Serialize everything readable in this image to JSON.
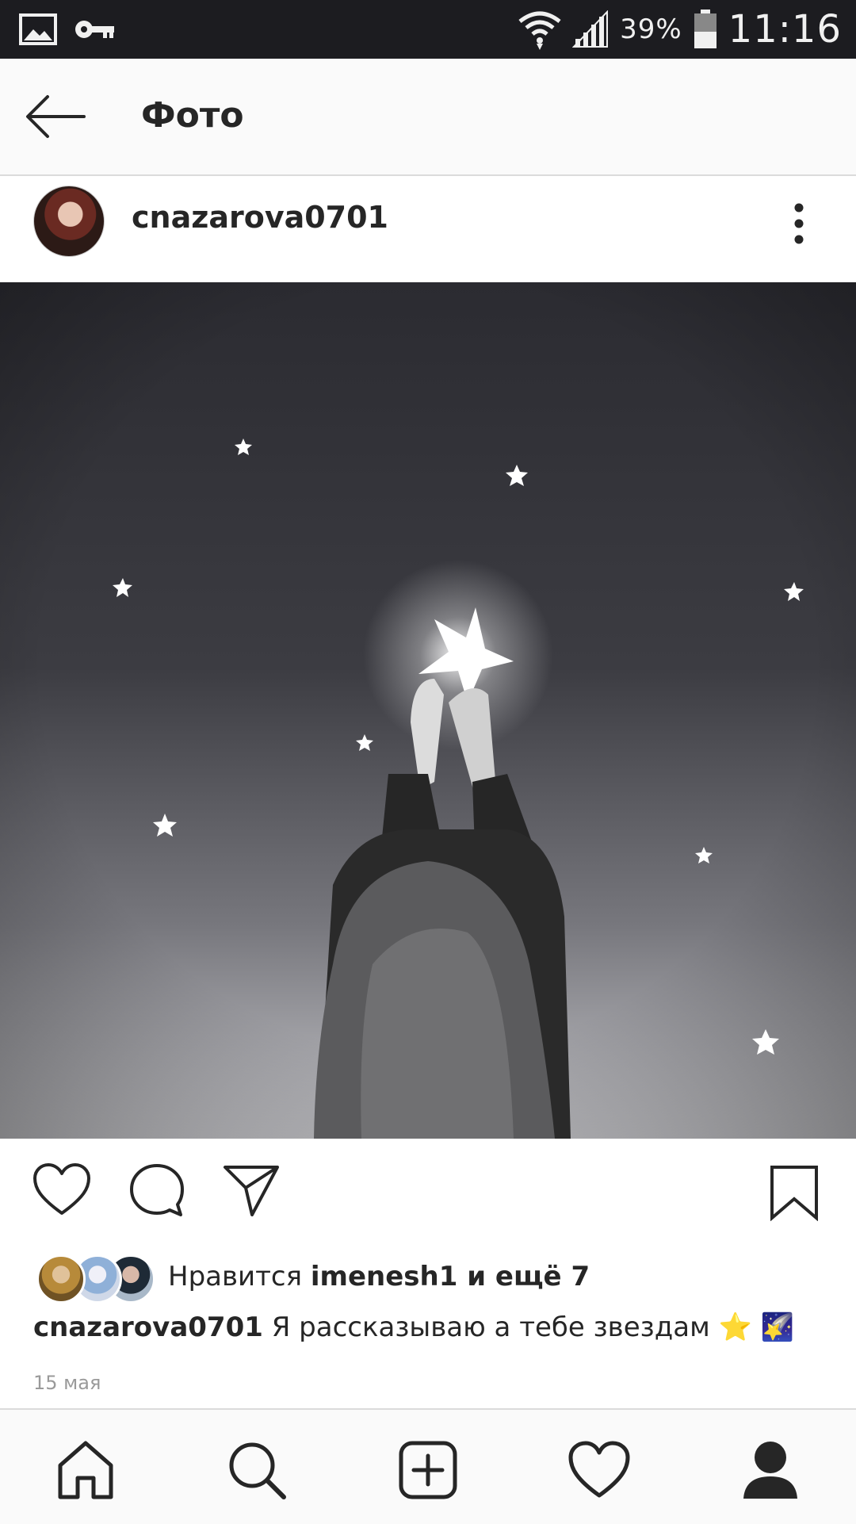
{
  "status_bar": {
    "battery_percent": "39%",
    "time": "11:16",
    "icons": [
      "image-icon",
      "key-icon",
      "wifi-icon",
      "signal-icon",
      "battery-icon"
    ]
  },
  "app_bar": {
    "title": "Фото"
  },
  "post": {
    "username": "cnazarova0701",
    "likes": {
      "prefix": "Нравится ",
      "user": "imenesh1",
      "suffix": " и ещё 7"
    },
    "caption": {
      "username": "cnazarova0701",
      "text": " Я рассказываю а тебе звездам ⭐ 🌠"
    },
    "date": "15 мая"
  },
  "bottom_nav": [
    "home-icon",
    "search-icon",
    "add-post-icon",
    "activity-heart-icon",
    "profile-icon"
  ],
  "colors": {
    "status_bar_bg": "#1c1c20",
    "text": "#262626",
    "muted": "#9a9a9a",
    "bars_bg": "#fafafa"
  }
}
